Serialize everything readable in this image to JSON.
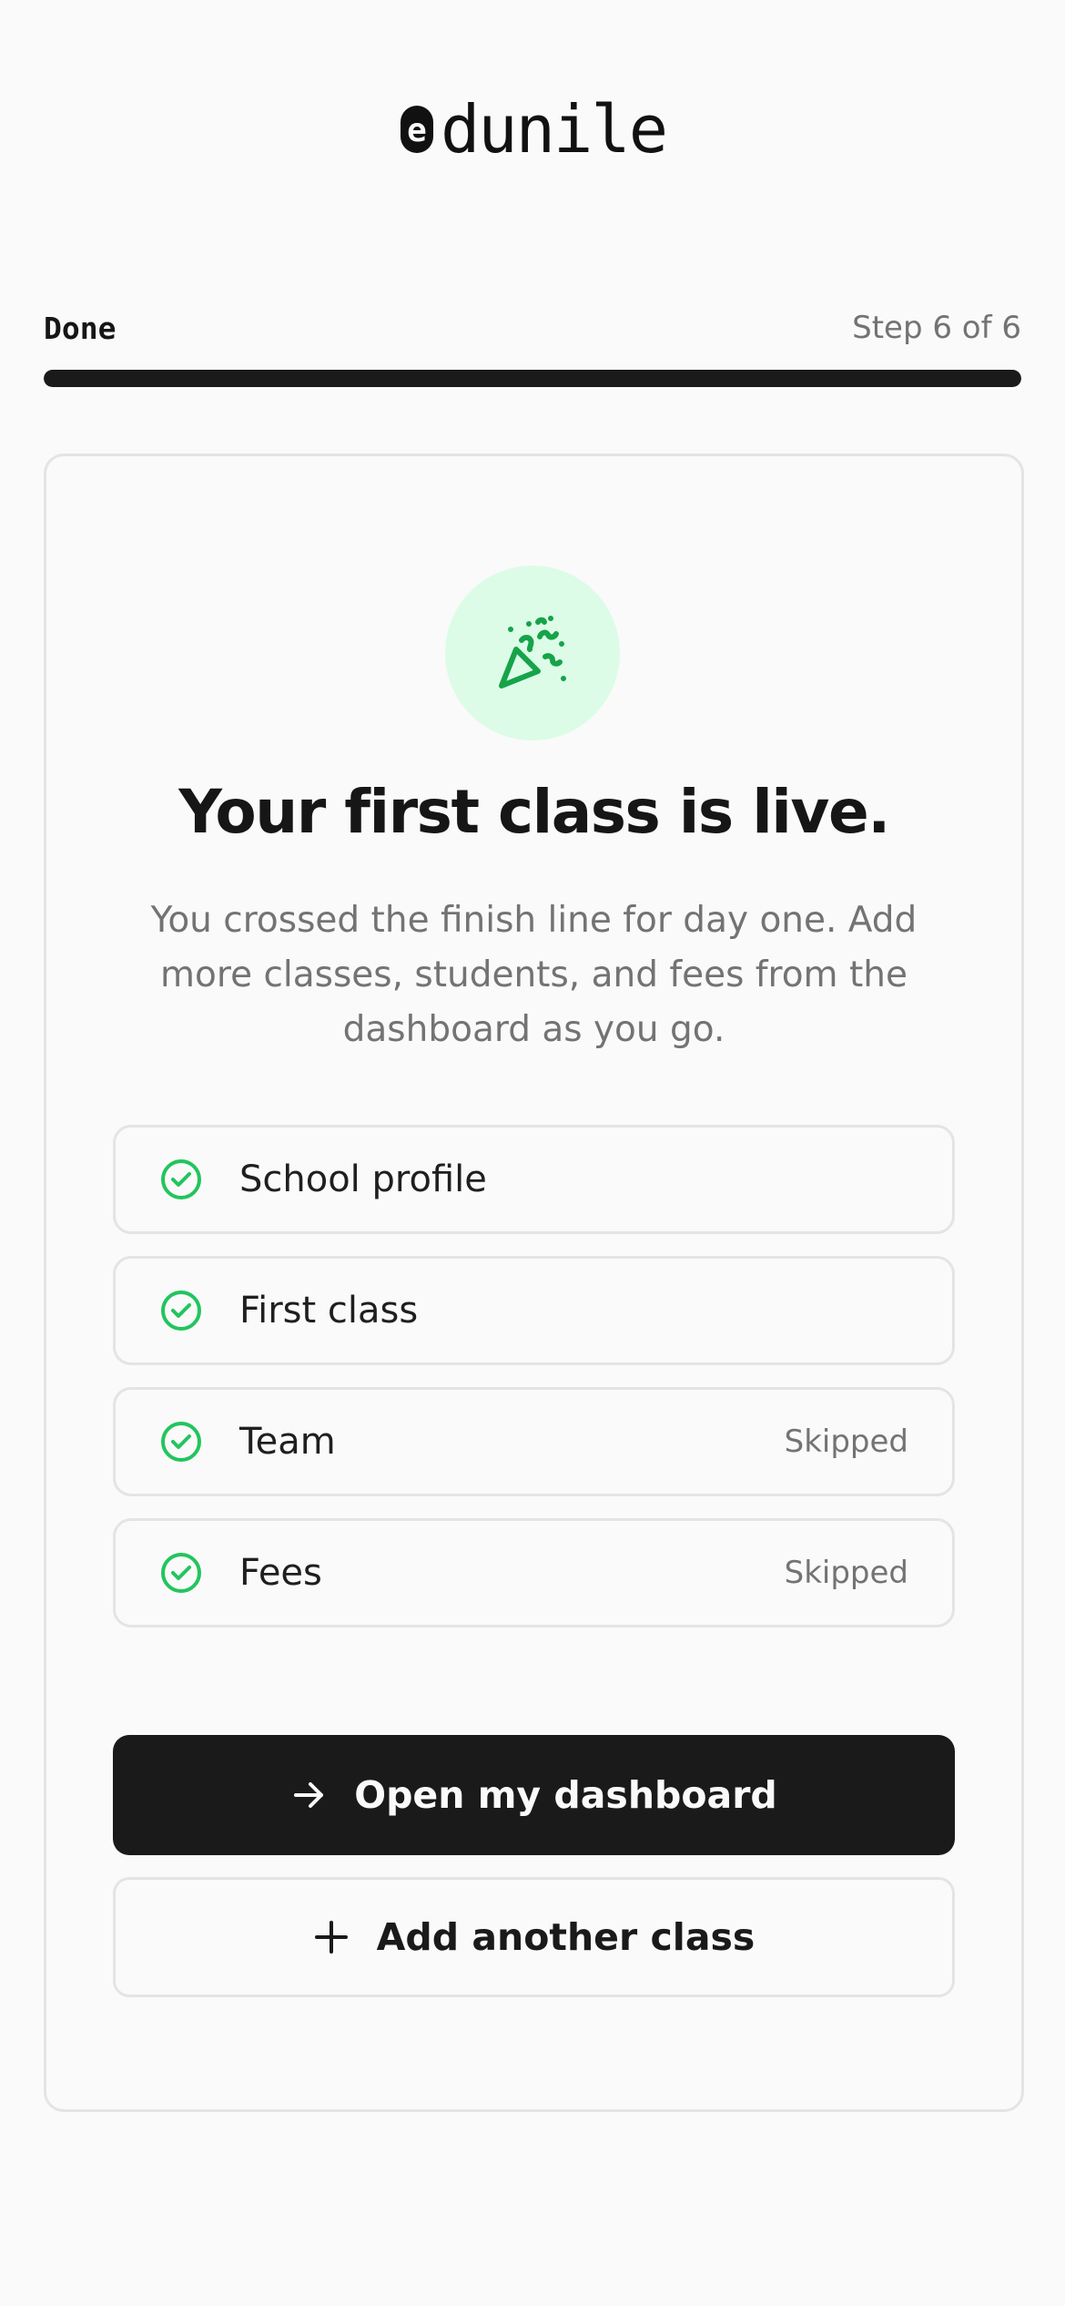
{
  "brand": {
    "name": "dunile",
    "mark_letter": "e"
  },
  "progress": {
    "label": "Done",
    "step_text": "Step 6 of 6",
    "fraction": 1.0
  },
  "card": {
    "icon": "party-popper-icon",
    "title": "Your first class is live.",
    "subtitle": "You crossed the finish line for day one. Add more classes, students, and fees from the dashboard as you go.",
    "checklist": [
      {
        "label": "School profile",
        "status": ""
      },
      {
        "label": "First class",
        "status": ""
      },
      {
        "label": "Team",
        "status": "Skipped"
      },
      {
        "label": "Fees",
        "status": "Skipped"
      }
    ],
    "primary_button": {
      "label": "Open my dashboard",
      "icon": "arrow-right-icon"
    },
    "secondary_button": {
      "label": "Add another class",
      "icon": "plus-icon"
    }
  },
  "colors": {
    "accent_green": "#22c55e",
    "icon_bg": "#dcfce7",
    "primary_dark": "#1a1a1a",
    "muted_text": "#737373"
  }
}
